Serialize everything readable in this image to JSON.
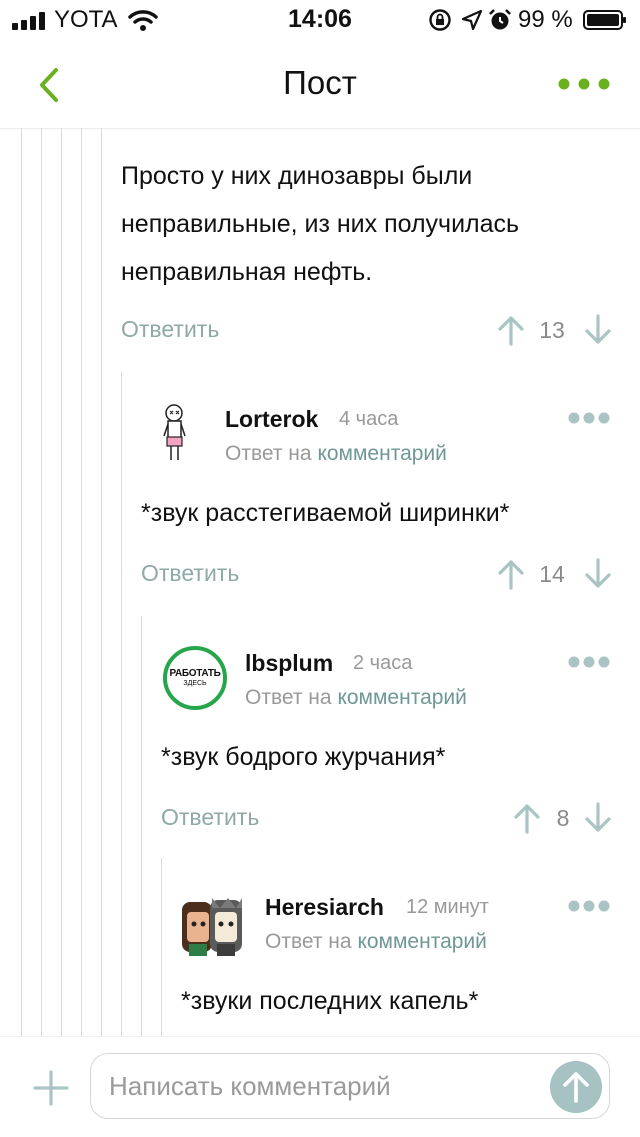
{
  "status_bar": {
    "carrier": "YOTA",
    "time": "14:06",
    "battery": "99 %"
  },
  "header": {
    "title": "Пост"
  },
  "colors": {
    "accent": "#6ab01f",
    "link": "#6f9795",
    "vote_icon": "#a9c4c3",
    "avatar_ring": "#26a64a"
  },
  "comments": [
    {
      "text": "Просто у них динозавры были неправильные, из них получилась неправильная нефть.",
      "reply_label": "Ответить",
      "score": "13"
    },
    {
      "author": "Lorterok",
      "time": "4 часа",
      "reply_prefix": "Ответ на",
      "reply_link": "комментарий",
      "text": "*звук расстегиваемой ширинки*",
      "reply_label": "Ответить",
      "score": "14"
    },
    {
      "author": "lbsplum",
      "time": "2 часа",
      "avatar_text_top": "РАБОТАТЬ",
      "avatar_text_bottom": "ЗДЕСЬ",
      "reply_prefix": "Ответ на",
      "reply_link": "комментарий",
      "text": "*звук бодрого журчания*",
      "reply_label": "Ответить",
      "score": "8"
    },
    {
      "author": "Heresiarch",
      "time": "12 минут",
      "reply_prefix": "Ответ на",
      "reply_link": "комментарий",
      "text": "*звуки последних капель*"
    }
  ],
  "composer": {
    "placeholder": "Написать комментарий"
  }
}
